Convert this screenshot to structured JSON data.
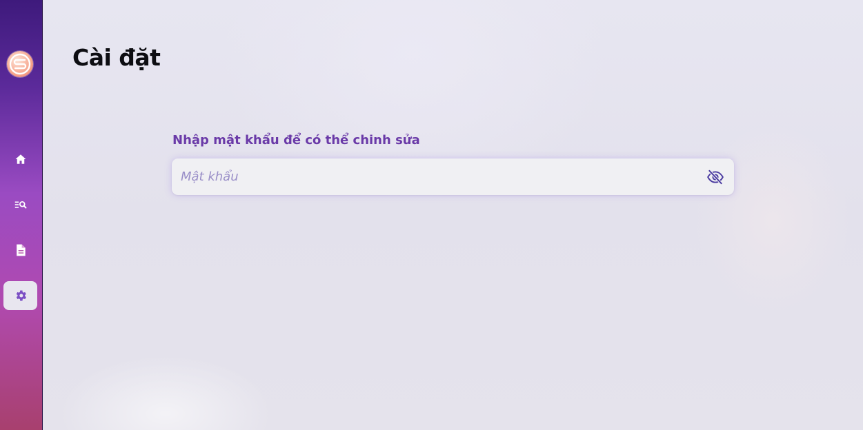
{
  "page": {
    "title": "Cài đặt"
  },
  "sidebar": {
    "logo_icon": "brand-logo",
    "items": [
      {
        "icon": "home-icon",
        "active": false
      },
      {
        "icon": "search-list-icon",
        "active": false
      },
      {
        "icon": "document-icon",
        "active": false
      },
      {
        "icon": "gear-icon",
        "active": true
      }
    ]
  },
  "password_form": {
    "label": "Nhập mật khẩu để có thể chinh sửa",
    "placeholder": "Mật khẩu",
    "value": "",
    "toggle_icon": "eye-off-icon"
  },
  "colors": {
    "accent": "#6a3aa8",
    "sidebar_top": "#3e1a7c",
    "sidebar_bottom": "#a8406e",
    "background": "#e5e3ec"
  }
}
